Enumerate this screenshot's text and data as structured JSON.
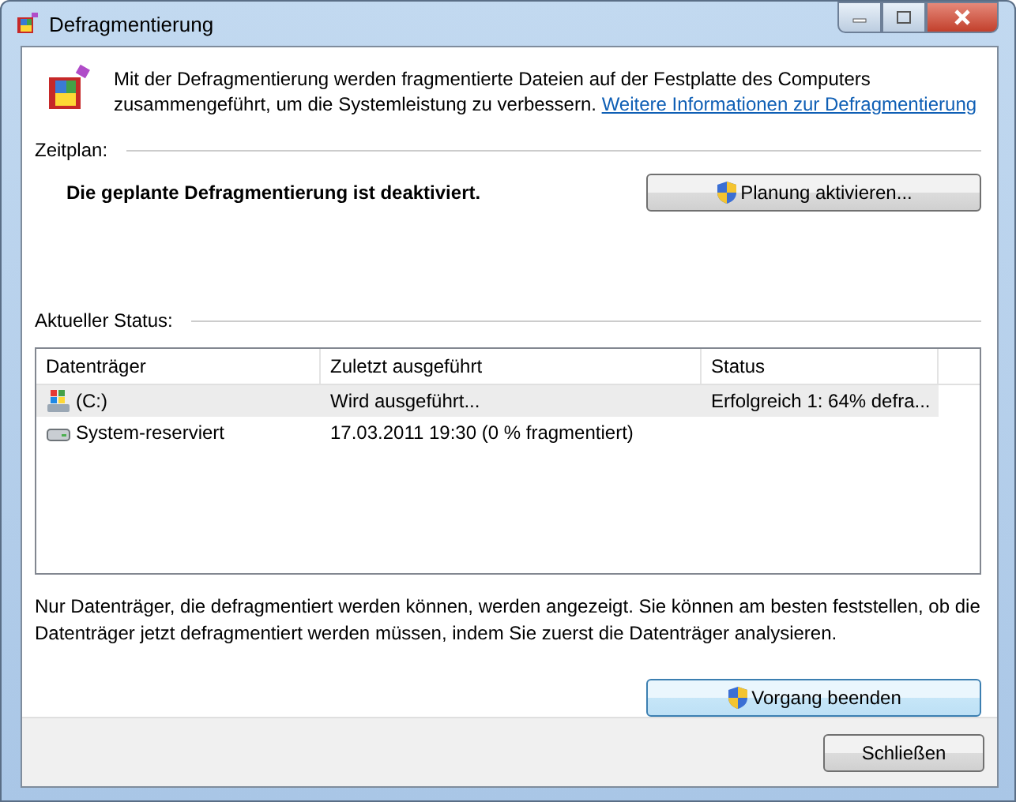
{
  "window": {
    "title": "Defragmentierung"
  },
  "intro": {
    "text": "Mit der Defragmentierung werden fragmentierte Dateien auf der Festplatte des Computers zusammengeführt, um die Systemleistung zu verbessern.",
    "link": "Weitere Informationen zur Defragmentierung"
  },
  "schedule": {
    "heading": "Zeitplan:",
    "message": "Die geplante Defragmentierung ist deaktiviert.",
    "button": "Planung aktivieren..."
  },
  "status": {
    "heading": "Aktueller Status:",
    "columns": [
      "Datenträger",
      "Zuletzt ausgeführt",
      "Status"
    ],
    "rows": [
      {
        "kind": "system",
        "name": "(C:)",
        "last_run": "Wird ausgeführt...",
        "status": "Erfolgreich 1: 64% defra...",
        "selected": true
      },
      {
        "kind": "drive",
        "name": "System-reserviert",
        "last_run": "17.03.2011 19:30 (0 % fragmentiert)",
        "status": "",
        "selected": false
      }
    ]
  },
  "note": "Nur Datenträger, die defragmentiert werden können, werden angezeigt. Sie können am besten feststellen, ob die Datenträger jetzt defragmentiert werden müssen, indem Sie zuerst die Datenträger analysieren.",
  "action_button": "Vorgang beenden",
  "close_button": "Schließen"
}
